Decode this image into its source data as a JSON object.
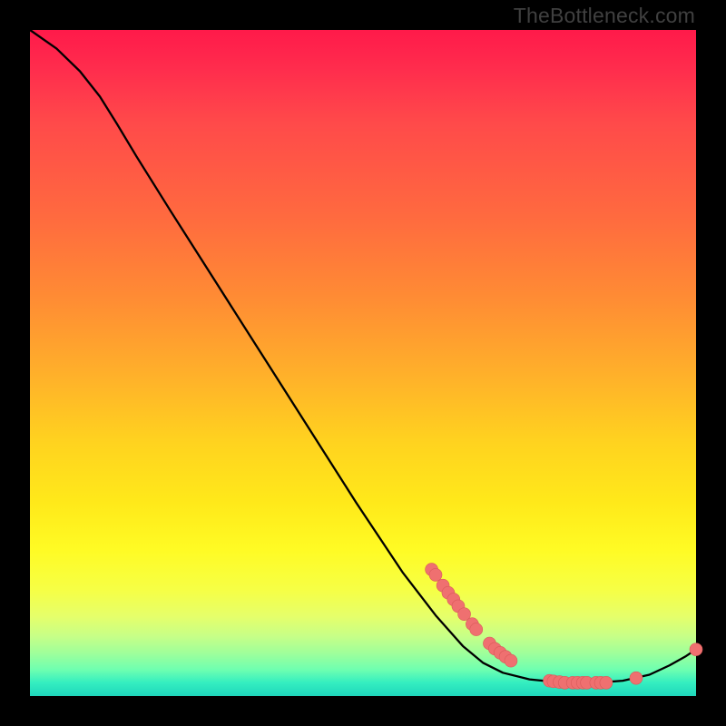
{
  "watermark_text": "TheBottleneck.com",
  "colors": {
    "background": "#000000",
    "curve": "#000000",
    "dot_fill": "#ef7070",
    "dot_stroke": "#d95a5a"
  },
  "chart_data": {
    "type": "line",
    "title": "",
    "xlabel": "",
    "ylabel": "",
    "xlim": [
      0,
      100
    ],
    "ylim": [
      0,
      100
    ],
    "curve_xy": [
      [
        0.0,
        100.0
      ],
      [
        4.0,
        97.2
      ],
      [
        7.5,
        93.8
      ],
      [
        10.5,
        90.0
      ],
      [
        13.0,
        86.0
      ],
      [
        16.0,
        81.0
      ],
      [
        21.0,
        73.0
      ],
      [
        28.0,
        62.0
      ],
      [
        35.0,
        51.0
      ],
      [
        42.0,
        40.0
      ],
      [
        49.0,
        29.0
      ],
      [
        56.0,
        18.5
      ],
      [
        61.0,
        12.0
      ],
      [
        65.0,
        7.5
      ],
      [
        68.0,
        5.0
      ],
      [
        71.0,
        3.5
      ],
      [
        75.0,
        2.5
      ],
      [
        80.0,
        2.0
      ],
      [
        85.0,
        2.0
      ],
      [
        89.0,
        2.3
      ],
      [
        93.0,
        3.2
      ],
      [
        96.0,
        4.6
      ],
      [
        98.5,
        6.0
      ],
      [
        100.0,
        7.0
      ]
    ],
    "dots_xy": [
      [
        60.3,
        19.0
      ],
      [
        60.9,
        18.2
      ],
      [
        62.0,
        16.6
      ],
      [
        62.8,
        15.5
      ],
      [
        63.6,
        14.5
      ],
      [
        64.3,
        13.5
      ],
      [
        65.2,
        12.3
      ],
      [
        66.4,
        10.8
      ],
      [
        67.0,
        10.0
      ],
      [
        69.0,
        7.9
      ],
      [
        69.8,
        7.1
      ],
      [
        70.6,
        6.5
      ],
      [
        71.4,
        5.9
      ],
      [
        72.2,
        5.3
      ],
      [
        78.0,
        2.3
      ],
      [
        78.6,
        2.2
      ],
      [
        79.5,
        2.1
      ],
      [
        80.3,
        2.0
      ],
      [
        81.5,
        2.0
      ],
      [
        82.2,
        2.0
      ],
      [
        83.0,
        2.0
      ],
      [
        83.6,
        2.0
      ],
      [
        85.0,
        2.0
      ],
      [
        85.7,
        2.0
      ],
      [
        86.5,
        2.0
      ],
      [
        91.0,
        2.7
      ],
      [
        100.0,
        7.0
      ]
    ],
    "dot_radius_px": 7
  }
}
